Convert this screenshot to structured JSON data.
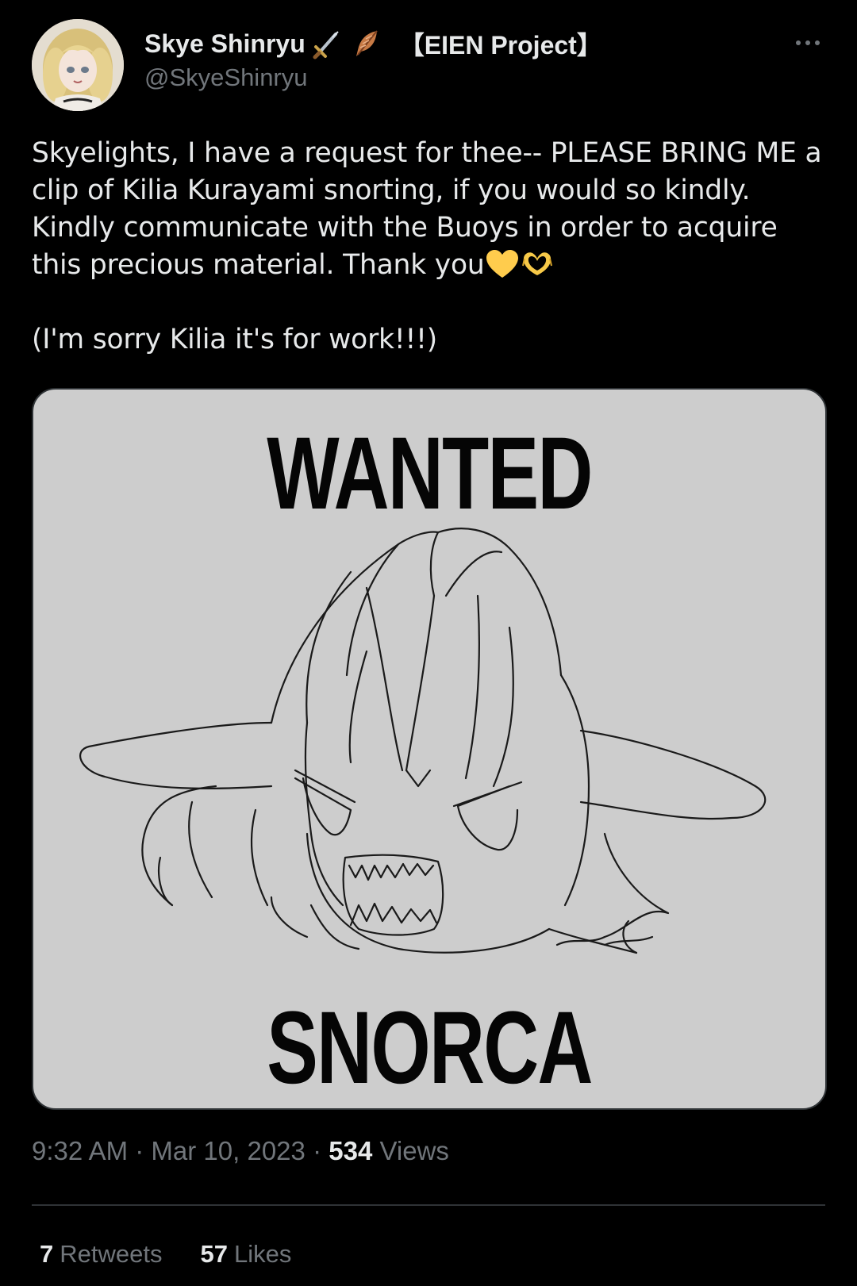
{
  "tweet": {
    "author": {
      "display_name": "Skye Shinryu",
      "name_emojis": [
        "dagger-icon",
        "feather-icon"
      ],
      "name_tag": "【EIEN Project】",
      "handle": "@SkyeShinryu"
    },
    "more_icon": "more-horizontal-icon",
    "text": {
      "paragraph_1": "Skyelights, I have a request for thee-- PLEASE BRING ME a clip of Kilia Kurayami snorting, if you would so kindly. Kindly communicate with the Buoys in order to acquire this precious material. Thank you",
      "paragraph_1_emojis": [
        "yellow-heart-icon",
        "heart-hands-icon"
      ],
      "paragraph_2": "(I'm sorry Kilia it's for work!!!)"
    },
    "media": {
      "poster_top": "WANTED",
      "poster_bottom": "SNORCA"
    },
    "time": "9:32 AM",
    "separator": "·",
    "date": "Mar 10, 2023",
    "views_count": "534",
    "views_label": "Views",
    "retweets_count": "7",
    "retweets_label": "Retweets",
    "likes_count": "57",
    "likes_label": "Likes"
  },
  "colors": {
    "background": "#000000",
    "primary_text": "#e7e9ea",
    "secondary_text": "#71767b",
    "divider": "#2f3336",
    "poster_background": "#cdcdcd"
  }
}
